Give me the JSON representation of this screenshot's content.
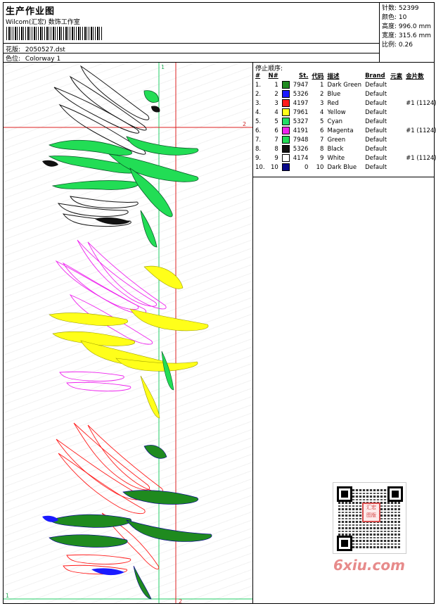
{
  "header": {
    "title": "生产作业图",
    "studio": "Wilcom(汇宏) 数饰工作室",
    "design_label": "花版:",
    "design_value": "2050527.dst",
    "colorway_label": "色位:",
    "colorway_value": "Colorway 1"
  },
  "stats": {
    "stitches": "针数: 52399",
    "colors": "颜色: 10",
    "height": "高度: 996.0 mm",
    "width": "宽度: 315.6 mm",
    "scale": "比例: 0.26"
  },
  "design": {
    "guide_green": "1",
    "guide_red": "2",
    "guide_green_bottom": "1",
    "guide_red_bottom": "2"
  },
  "stop_sequence": {
    "label": "停止顺序:",
    "columns": [
      "#",
      "N#",
      "St.",
      "代码",
      "描述",
      "Brand",
      "元素",
      "金片数"
    ],
    "rows": [
      {
        "idx": "1.",
        "n": "1",
        "color": "#1f8a1f",
        "st": "7947",
        "code": "1",
        "desc": "Dark Green",
        "brand": "Default",
        "elem": "",
        "seq": ""
      },
      {
        "idx": "2.",
        "n": "2",
        "color": "#1a1aff",
        "st": "5326",
        "code": "2",
        "desc": "Blue",
        "brand": "Default",
        "elem": "",
        "seq": ""
      },
      {
        "idx": "3.",
        "n": "3",
        "color": "#ff1a1a",
        "st": "4197",
        "code": "3",
        "desc": "Red",
        "brand": "Default",
        "elem": "",
        "seq": "#1 (1124)"
      },
      {
        "idx": "4.",
        "n": "4",
        "color": "#ffff1a",
        "st": "7961",
        "code": "4",
        "desc": "Yellow",
        "brand": "Default",
        "elem": "",
        "seq": ""
      },
      {
        "idx": "5.",
        "n": "5",
        "color": "#22dd66",
        "st": "5327",
        "code": "5",
        "desc": "Cyan",
        "brand": "Default",
        "elem": "",
        "seq": ""
      },
      {
        "idx": "6.",
        "n": "6",
        "color": "#ee22ee",
        "st": "4191",
        "code": "6",
        "desc": "Magenta",
        "brand": "Default",
        "elem": "",
        "seq": "#1 (1124)"
      },
      {
        "idx": "7.",
        "n": "7",
        "color": "#22dd55",
        "st": "7948",
        "code": "7",
        "desc": "Green",
        "brand": "Default",
        "elem": "",
        "seq": ""
      },
      {
        "idx": "8.",
        "n": "8",
        "color": "#111111",
        "st": "5326",
        "code": "8",
        "desc": "Black",
        "brand": "Default",
        "elem": "",
        "seq": ""
      },
      {
        "idx": "9.",
        "n": "9",
        "color": "#ffffff",
        "st": "4174",
        "code": "9",
        "desc": "White",
        "brand": "Default",
        "elem": "",
        "seq": "#1 (1124)"
      },
      {
        "idx": "10.",
        "n": "10",
        "color": "#0a0a8a",
        "st": "0",
        "code": "10",
        "desc": "Dark Blue",
        "brand": "Default",
        "elem": "",
        "seq": ""
      }
    ]
  },
  "watermark": {
    "seal_text": "汇宏 图版",
    "site": "6xiu.com"
  }
}
